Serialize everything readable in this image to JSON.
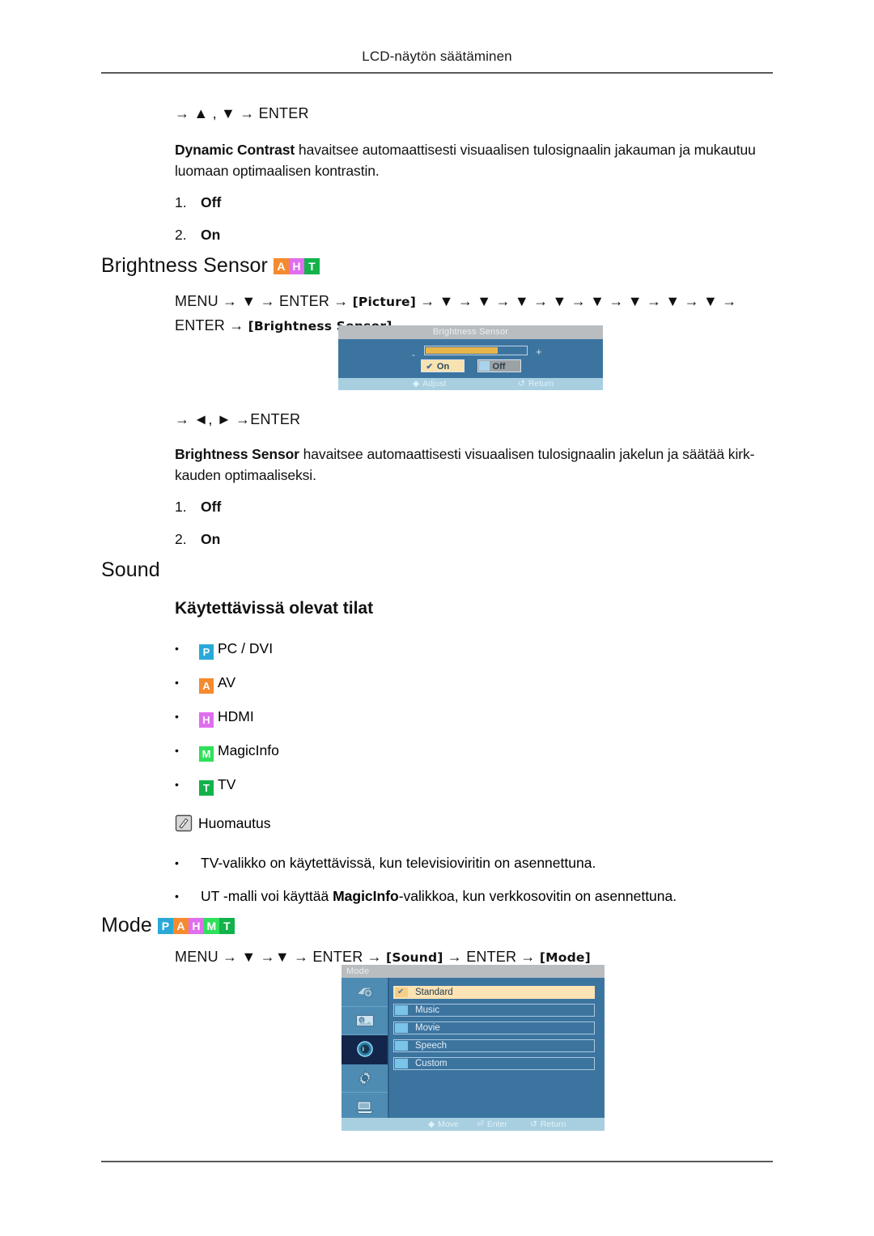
{
  "page": {
    "running_header": "LCD-näytön säätäminen"
  },
  "colors": {
    "badge_p": "#2aa9d8",
    "badge_a": "#f58a2e",
    "badge_h": "#e06ef0",
    "badge_m": "#2fe05a",
    "badge_t": "#13b24a",
    "osd_bg": "#3c74a0",
    "osd_titlebar": "#b9bdc0",
    "osd_footer": "#a8cfe0",
    "osd_highlight": "#fbe3b4",
    "slider_fill": "#e8b44c",
    "osd_selected_icon_bg": "#13254a"
  },
  "dynamic_contrast": {
    "keyline": "→ ▲ , ▼ → ENTER",
    "description_bold": "Dynamic Contrast",
    "description_rest": " havaitsee automaattisesti visuaalisen tulosignaalin jakauman ja mukautuu luomaan optimaalisen kontrastin.",
    "options": [
      {
        "num": "1.",
        "value": "Off"
      },
      {
        "num": "2.",
        "value": "On"
      }
    ]
  },
  "brightness_sensor": {
    "heading": "Brightness Sensor",
    "badges": [
      {
        "letter": "A",
        "name": "badge-av",
        "color": "#f58a2e"
      },
      {
        "letter": "H",
        "name": "badge-hdmi",
        "color": "#e06ef0"
      },
      {
        "letter": "T",
        "name": "badge-tv",
        "color": "#13b24a"
      }
    ],
    "menu_path_line1_prefix": "MENU → ▼ → ENTER → ",
    "menu_path_token1": "[Picture]",
    "menu_path_arrows": " → ▼ → ▼ → ▼ → ▼ → ▼ → ▼ → ▼ → ▼ → ENTER → ",
    "menu_path_token2": "[Brightness Sensor]",
    "keyline": "→ ◄, ► →ENTER",
    "description_bold": "Brightness Sensor",
    "description_rest": " havaitsee automaattisesti visuaalisen tulosignaalin jakelun ja säätää kirk-kauden optimaaliseksi.",
    "options": [
      {
        "num": "1.",
        "value": "Off"
      },
      {
        "num": "2.",
        "value": "On"
      }
    ],
    "osd": {
      "title": "Brightness Sensor",
      "minus_label": "-",
      "plus_label": "+",
      "slider_percent": 72,
      "button_on": "On",
      "button_off": "Off",
      "check_glyph": "✔",
      "footer_adjust": "Adjust",
      "footer_adjust_icon": "◆",
      "footer_return": "Return",
      "footer_return_icon": "↺"
    }
  },
  "sound": {
    "heading": "Sound",
    "subheading": "Käytettävissä olevat tilat",
    "modes": [
      {
        "letter": "P",
        "label": "PC / DVI",
        "color": "#2aa9d8",
        "name": "mode-pc-dvi"
      },
      {
        "letter": "A",
        "label": "AV",
        "color": "#f58a2e",
        "name": "mode-av"
      },
      {
        "letter": "H",
        "label": "HDMI",
        "color": "#e06ef0",
        "name": "mode-hdmi"
      },
      {
        "letter": "M",
        "label": "MagicInfo",
        "color": "#2fe05a",
        "name": "mode-magicinfo"
      },
      {
        "letter": "T",
        "label": "TV",
        "color": "#13b24a",
        "name": "mode-tv"
      }
    ],
    "bullet": "•",
    "note": {
      "title": "Huomautus",
      "items": [
        {
          "text": "TV-valikko on käytettävissä, kun televisioviritin on asennettuna.",
          "bold": "",
          "pre": "",
          "post": ""
        },
        {
          "pre": "UT -malli voi käyttää ",
          "bold": "MagicInfo",
          "post": "-valikkoa, kun verkkosovitin on asennettuna."
        }
      ]
    }
  },
  "mode": {
    "heading": "Mode",
    "badges": [
      {
        "letter": "P",
        "name": "badge-pc",
        "color": "#2aa9d8"
      },
      {
        "letter": "A",
        "name": "badge-av",
        "color": "#f58a2e"
      },
      {
        "letter": "H",
        "name": "badge-hdmi",
        "color": "#e06ef0"
      },
      {
        "letter": "M",
        "name": "badge-magicinfo",
        "color": "#2fe05a"
      },
      {
        "letter": "T",
        "name": "badge-tv",
        "color": "#13b24a"
      }
    ],
    "menu_path_prefix": "MENU → ▼ →▼ → ENTER → ",
    "menu_path_token1": "[Sound]",
    "menu_path_mid": " → ENTER → ",
    "menu_path_token2": "[Mode]",
    "osd": {
      "title": "Mode",
      "check_glyph": "✔",
      "items": [
        {
          "label": "Standard",
          "selected": true
        },
        {
          "label": "Music",
          "selected": false
        },
        {
          "label": "Movie",
          "selected": false
        },
        {
          "label": "Speech",
          "selected": false
        },
        {
          "label": "Custom",
          "selected": false
        }
      ],
      "sidebar_icons": [
        {
          "name": "input-source-icon",
          "selected": false
        },
        {
          "name": "picture-icon",
          "selected": false
        },
        {
          "name": "sound-icon",
          "selected": true
        },
        {
          "name": "setup-icon",
          "selected": false
        },
        {
          "name": "multi-control-icon",
          "selected": false
        }
      ],
      "footer_move": "Move",
      "footer_move_icon": "◆",
      "footer_enter": "Enter",
      "footer_enter_icon": "⏎",
      "footer_return": "Return",
      "footer_return_icon": "↺"
    }
  }
}
